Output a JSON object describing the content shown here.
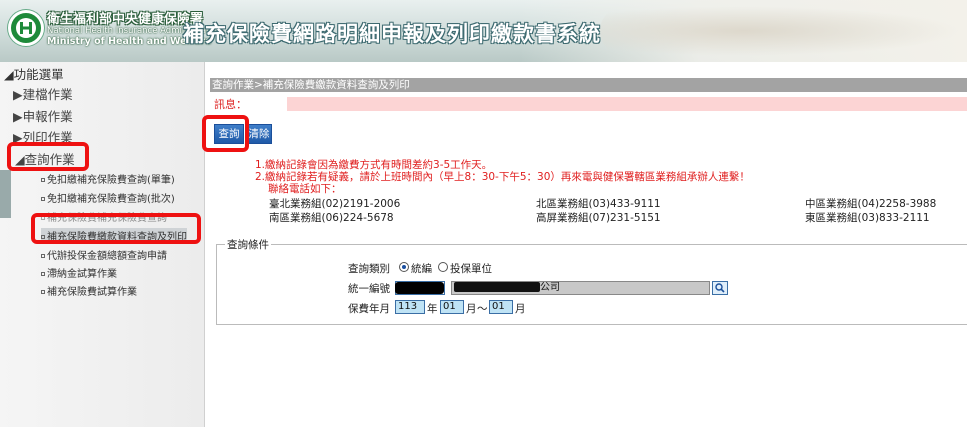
{
  "header": {
    "org_name": "衛生福利部中央健康保險署",
    "org_en_line1": "National Health Insurance Administration,",
    "org_en_line2": "Ministry of Health and Welfare",
    "system_title": "補充保險費網路明細申報及列印繳款書系統",
    "logo": "nhi-logo-icon"
  },
  "sidebar": {
    "title": "功能選單",
    "categories": [
      {
        "label": "建檔作業",
        "icon": "triangle-right-icon"
      },
      {
        "label": "申報作業",
        "icon": "triangle-right-icon"
      },
      {
        "label": "列印作業",
        "icon": "triangle-right-icon"
      },
      {
        "label": "查詢作業",
        "icon": "triangle-down-icon"
      }
    ],
    "subitems": [
      {
        "label": "免扣繳補充保險費查詢(單筆)"
      },
      {
        "label": "免扣繳補充保險費查詢(批次)"
      },
      {
        "label": "補充保險費補充保險費查詢"
      },
      {
        "label": "補充保險費繳款資料查詢及列印"
      },
      {
        "label": "代辦投保金額總額查詢申請"
      },
      {
        "label": "滯納金試算作業"
      },
      {
        "label": "補充保險費試算作業"
      }
    ]
  },
  "main": {
    "breadcrumb": "查詢作業>補充保險費繳款資料查詢及列印",
    "message_label": "訊息：",
    "buttons": {
      "query": "查詢",
      "clear": "清除"
    },
    "notes": [
      "1.繳納記錄會因為繳費方式有時間差約3-5工作天。",
      "2.繳納記錄若有疑義，請於上班時間內（早上8：30-下午5：30）再來電與健保署轄區業務組承辦人連繫！",
      "聯絡電話如下："
    ],
    "offices": [
      [
        "臺北業務組(02)2191-2006",
        "北區業務組(03)433-9111",
        "中區業務組(04)2258-3988"
      ],
      [
        "南區業務組(06)224-5678",
        "高屏業務組(07)231-5151",
        "東區業務組(03)833-2111"
      ]
    ],
    "conditions": {
      "legend": "查詢條件",
      "type_label": "查詢類別",
      "type_options": [
        "統編",
        "投保單位"
      ],
      "type_selected": "統編",
      "tax_id_label": "統一編號",
      "company_suffix": "公司",
      "period_label": "保費年月",
      "year": "113",
      "year_unit": "年",
      "month_from": "01",
      "month_unit1": "月",
      "range_sep": "～",
      "month_to": "01",
      "month_unit2": "月"
    }
  },
  "colors": {
    "highlight": "#ee1111",
    "breadcrumb_bg": "#a3a3a3",
    "message_bg": "#fcd4d4",
    "button_blue": "#1f5aa8",
    "notes_red": "#e02020",
    "input_blue": "#bfe3f5"
  }
}
